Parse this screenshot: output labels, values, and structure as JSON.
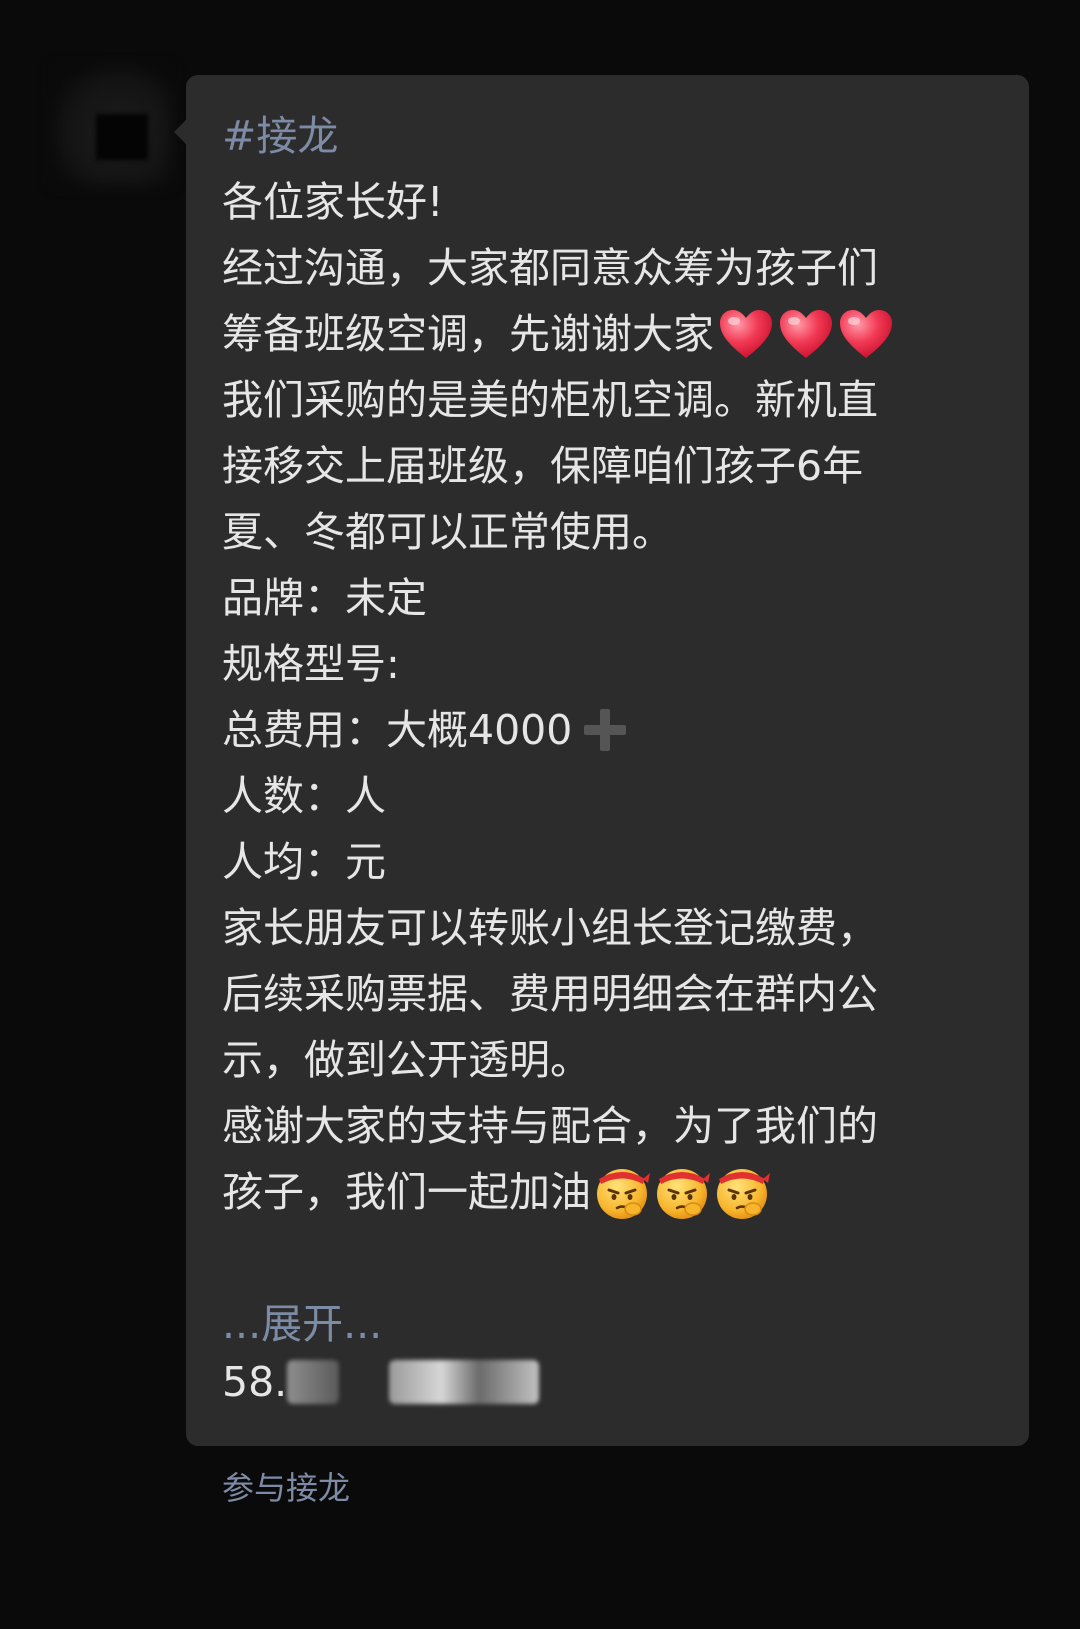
{
  "post": {
    "hashtag": "#接龙",
    "lines": [
      "各位家长好!",
      "经过沟通，大家都同意众筹为孩子们",
      "筹备班级空调，先谢谢大家",
      "我们采购的是美的柜机空调。新机直",
      "接移交上届班级，保障咱们孩子6年",
      "夏、冬都可以正常使用。",
      "品牌：未定",
      "规格型号:",
      "总费用：大概4000",
      "人数：人",
      "人均：元",
      "家长朋友可以转账小组长登记缴费，",
      "后续采购票据、费用明细会在群内公",
      "示，做到公开透明。",
      "感谢大家的支持与配合，为了我们的",
      "孩子，我们一起加油"
    ],
    "heart_emoji": "heart-emoji",
    "face_emoji": "determined-face-emoji",
    "plus_icon": "plus-icon"
  },
  "expand_label": "...展开...",
  "entry_prefix": "58.",
  "participate_label": "参与接龙",
  "colors": {
    "background": "#0a0a0a",
    "bubble": "#2c2c2c",
    "text": "#e6e6e6",
    "link": "#7d8ba6"
  }
}
